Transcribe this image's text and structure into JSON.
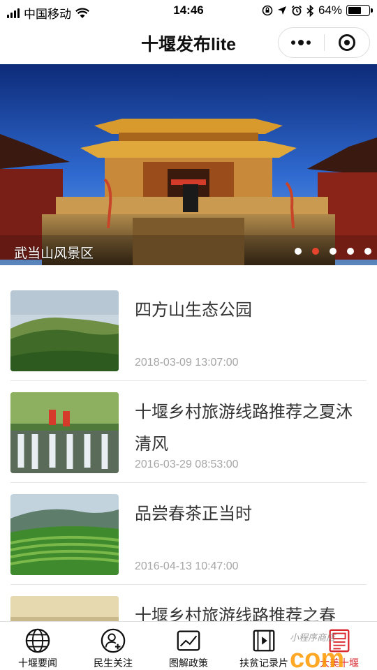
{
  "status_bar": {
    "carrier": "中国移动",
    "time": "14:46",
    "battery_percent": "64%",
    "battery_level": 0.64,
    "icons": [
      "signal-icon",
      "wifi-icon",
      "rotation-lock-icon",
      "location-icon",
      "alarm-icon",
      "bluetooth-icon",
      "battery-icon"
    ]
  },
  "nav": {
    "title": "十堰发布lite",
    "icons": [
      "more-icon",
      "close-miniapp-icon"
    ]
  },
  "banner": {
    "caption": "武当山风景区",
    "slide_count": 5,
    "active_index": 1,
    "colors": {
      "active_dot": "#e6442c",
      "dot": "#ffffff"
    }
  },
  "articles": [
    {
      "title": "四方山生态公园",
      "date": "2018-03-09 13:07:00",
      "image": "forest-hills-photo"
    },
    {
      "title": "十堰乡村旅游线路推荐之夏沐清风",
      "date": "2016-03-29 08:53:00",
      "image": "waterfall-photo"
    },
    {
      "title": "品尝春茶正当时",
      "date": "2016-04-13 10:47:00",
      "image": "tea-terrace-photo"
    },
    {
      "title": "十堰乡村旅游线路推荐之春",
      "date": "",
      "image": "spring-village-photo"
    }
  ],
  "tabbar": {
    "items": [
      {
        "label": "十堰要闻",
        "icon": "globe-icon"
      },
      {
        "label": "民生关注",
        "icon": "person-add-icon"
      },
      {
        "label": "图解政策",
        "icon": "image-chart-icon"
      },
      {
        "label": "扶贫记录片",
        "icon": "film-icon"
      },
      {
        "label": "大美十堰",
        "icon": "newspaper-icon"
      }
    ],
    "active_index": 4,
    "colors": {
      "active": "#d9272e",
      "inactive": "#111111"
    }
  },
  "watermark": {
    "text": "com",
    "handwritten": "小程序商店"
  }
}
